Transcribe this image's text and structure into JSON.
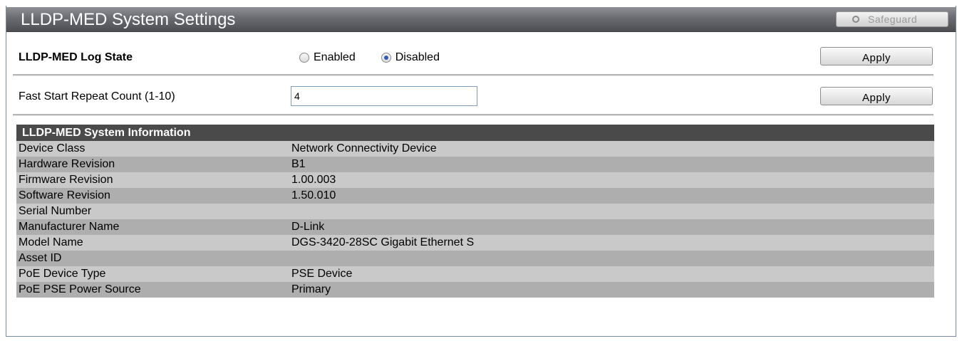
{
  "window": {
    "title": "LLDP-MED System Settings",
    "safeguard_label": "Safeguard"
  },
  "log_state": {
    "label": "LLDP-MED Log State",
    "options": [
      "Enabled",
      "Disabled"
    ],
    "selected": "Disabled",
    "apply_label": "Apply"
  },
  "fast_start": {
    "label": "Fast Start Repeat Count (1-10)",
    "value": "4",
    "apply_label": "Apply"
  },
  "system_info": {
    "header": "LLDP-MED System Information",
    "rows": [
      {
        "key": "Device Class",
        "value": "Network Connectivity Device"
      },
      {
        "key": "Hardware Revision",
        "value": "B1"
      },
      {
        "key": "Firmware Revision",
        "value": "1.00.003"
      },
      {
        "key": "Software Revision",
        "value": "1.50.010"
      },
      {
        "key": "Serial Number",
        "value": ""
      },
      {
        "key": "Manufacturer Name",
        "value": "D-Link"
      },
      {
        "key": "Model Name",
        "value": "DGS-3420-28SC Gigabit Ethernet S"
      },
      {
        "key": "Asset ID",
        "value": ""
      },
      {
        "key": "PoE Device Type",
        "value": "PSE Device"
      },
      {
        "key": "PoE PSE Power Source",
        "value": "Primary"
      }
    ]
  },
  "colors": {
    "header_bg": "#4a4a4a",
    "row_light": "#c9c9c9",
    "row_dark": "#aeaeae",
    "radio_selected": "#2a5db8"
  },
  "icons": {
    "safeguard": "circle-outline-icon"
  }
}
